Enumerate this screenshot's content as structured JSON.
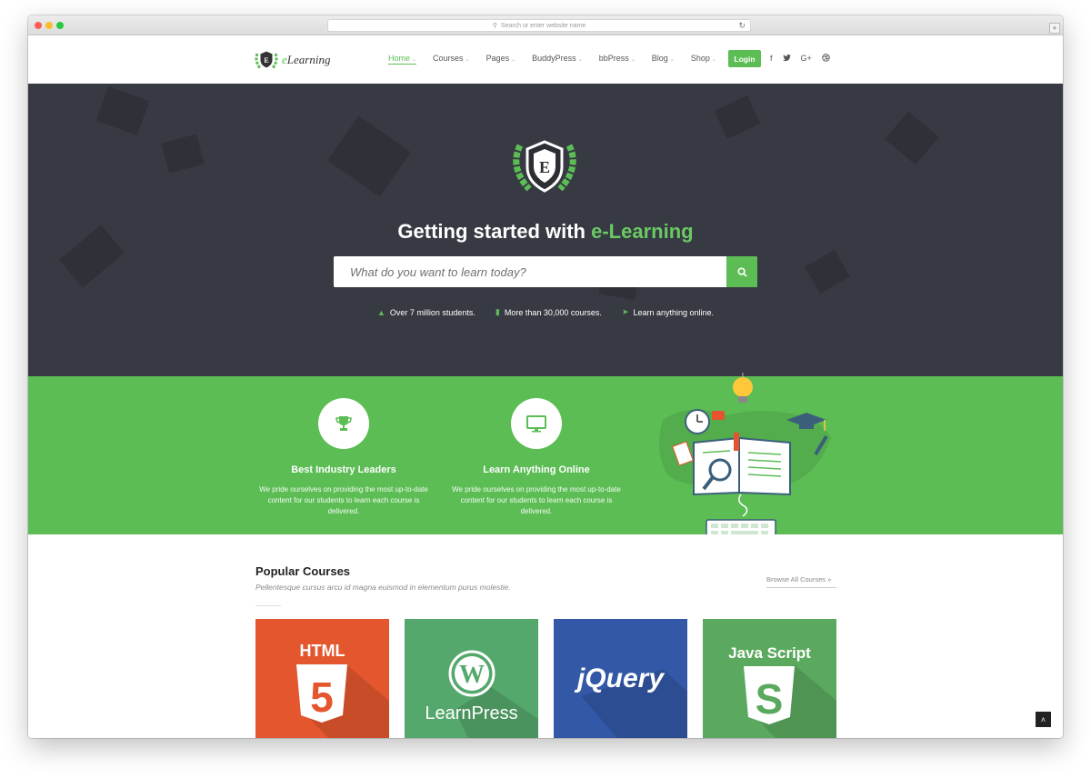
{
  "browser": {
    "address_placeholder": "Search or enter website name"
  },
  "brand": {
    "logo_prefix": "e",
    "logo_rest": "Learning",
    "emblem_letter": "E"
  },
  "nav": {
    "items": [
      {
        "label": "Home",
        "active": true
      },
      {
        "label": "Courses",
        "active": false
      },
      {
        "label": "Pages",
        "active": false
      },
      {
        "label": "BuddyPress",
        "active": false
      },
      {
        "label": "bbPress",
        "active": false
      },
      {
        "label": "Blog",
        "active": false
      },
      {
        "label": "Shop",
        "active": false
      }
    ],
    "login_label": "Login",
    "social": [
      "f",
      "t",
      "G+",
      "dribbble"
    ]
  },
  "hero": {
    "title_main": "Getting started with ",
    "title_accent": "e-Learning",
    "search_placeholder": "What do you want to learn today?",
    "stats": [
      {
        "icon": "graduation-cap-icon",
        "text": "Over 7 million students."
      },
      {
        "icon": "book-icon",
        "text": "More than 30,000 courses."
      },
      {
        "icon": "paper-plane-icon",
        "text": "Learn anything online."
      }
    ]
  },
  "features": [
    {
      "icon": "trophy-icon",
      "title": "Best Industry Leaders",
      "desc": "We pride ourselves on providing the most up-to-date content for our students to learn each course is delivered."
    },
    {
      "icon": "monitor-icon",
      "title": "Learn Anything Online",
      "desc": "We pride ourselves on providing the most up-to-date content for our students to learn each course is delivered."
    }
  ],
  "popular": {
    "title": "Popular Courses",
    "subtitle": "Pellentesque cursus arcu id magna euismod in elementum purus molestie.",
    "browse_label": "Browse All Courses",
    "courses": [
      {
        "label": "HTML",
        "badge": "5",
        "color": "#e4572e"
      },
      {
        "label": "LearnPress",
        "color": "#55a86b"
      },
      {
        "label": "jQuery",
        "color": "#3458a8"
      },
      {
        "label": "Java Script",
        "badge": "S",
        "color": "#5aa95e"
      }
    ]
  },
  "colors": {
    "accent": "#5cbd55",
    "hero_bg": "#373a42"
  },
  "top_button": "^"
}
